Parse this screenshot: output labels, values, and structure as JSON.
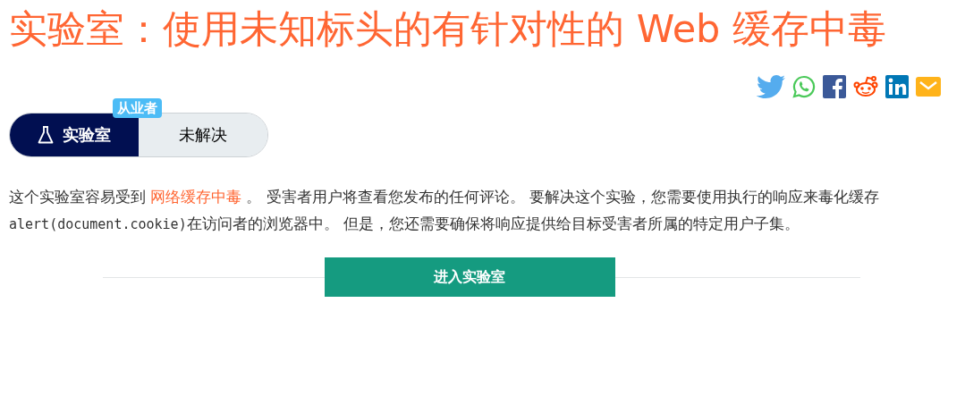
{
  "title": "实验室：使用未知标头的有针对性的 Web 缓存中毒",
  "badge": "从业者",
  "labels": [
    {
      "kind": "lab",
      "text": "实验室"
    },
    {
      "kind": "status",
      "text": "未解决"
    }
  ],
  "description": {
    "before": "这个实验室容易受到 ",
    "link": "网络缓存中毒",
    "middle": " 。 受害者用户将查看您发布的任何评论。 要解决这个实验，您需要使用执行的响应来毒化缓存 ",
    "code": "alert(document.cookie)",
    "after": "在访问者的浏览器中。 但是，您还需要确保将响应提供给目标受害者所属的特定用户子集。"
  },
  "button": "进入实验室"
}
